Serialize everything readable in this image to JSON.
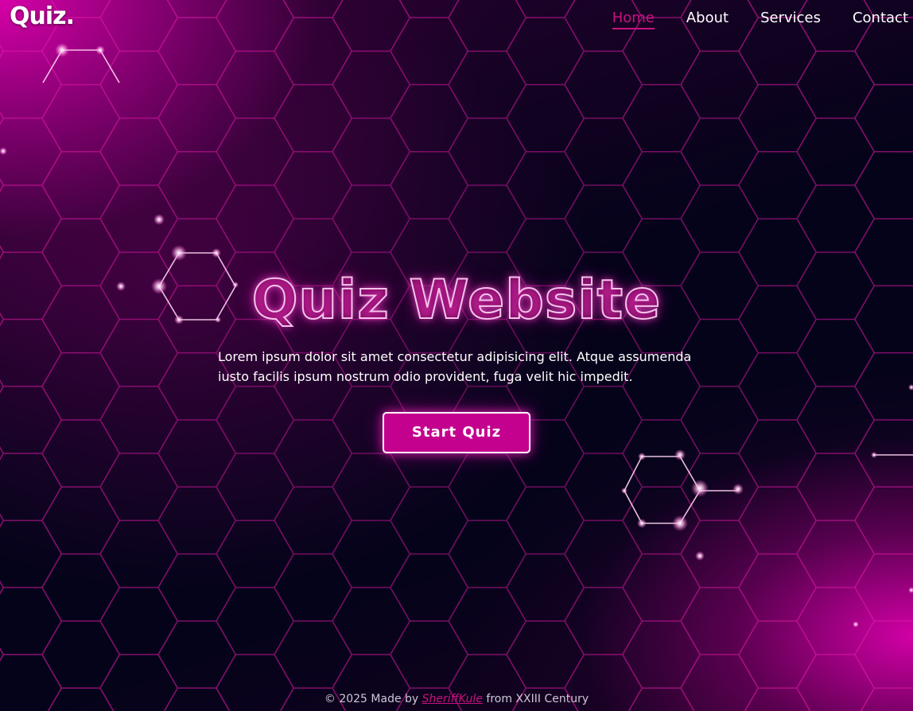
{
  "header": {
    "logo": "Quiz.",
    "nav": [
      {
        "label": "Home",
        "active": true
      },
      {
        "label": "About",
        "active": false
      },
      {
        "label": "Services",
        "active": false
      },
      {
        "label": "Contact",
        "active": false
      }
    ]
  },
  "hero": {
    "title": "Quiz Website",
    "description": "Lorem ipsum dolor sit amet consectetur adipisicing elit. Atque assumenda iusto facilis ipsum nostrum odio provident, fuga velit hic impedit.",
    "button_label": "Start Quiz"
  },
  "footer": {
    "prefix": "© 2025 Made by ",
    "author": "SheriffKule",
    "suffix": " from XXIII Century"
  },
  "colors": {
    "accent": "#c8127e",
    "button_bg": "#c4008f",
    "background": "#05031a",
    "glow": "#e000af"
  }
}
